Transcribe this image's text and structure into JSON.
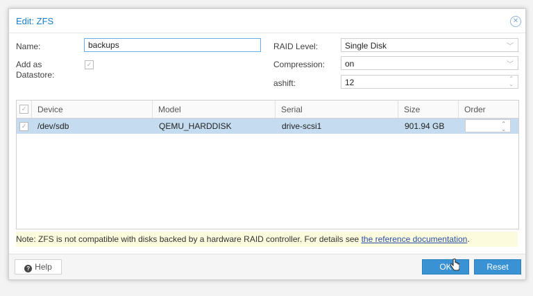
{
  "dialog": {
    "title": "Edit: ZFS",
    "close_icon": "close-icon"
  },
  "form": {
    "name_label": "Name:",
    "name_value": "backups",
    "add_datastore_label_1": "Add as",
    "add_datastore_label_2": "Datastore:",
    "add_datastore_checked": true,
    "raid_label": "RAID Level:",
    "raid_value": "Single Disk",
    "compression_label": "Compression:",
    "compression_value": "on",
    "ashift_label": "ashift:",
    "ashift_value": "12"
  },
  "grid": {
    "columns": [
      "Device",
      "Model",
      "Serial",
      "Size",
      "Order"
    ],
    "rows": [
      {
        "checked": true,
        "device": "/dev/sdb",
        "model": "QEMU_HARDDISK",
        "serial": "drive-scsi1",
        "size": "901.94 GB",
        "order": ""
      }
    ]
  },
  "note": {
    "text": "Note: ZFS is not compatible with disks backed by a hardware RAID controller. For details see ",
    "link": "the reference documentation",
    "suffix": "."
  },
  "footer": {
    "help_label": "Help",
    "ok_label": "OK",
    "reset_label": "Reset"
  },
  "colors": {
    "accent": "#157fcc",
    "button": "#3892d4",
    "selected_row": "#c5dcf0",
    "note_bg": "#fcfbdd"
  }
}
